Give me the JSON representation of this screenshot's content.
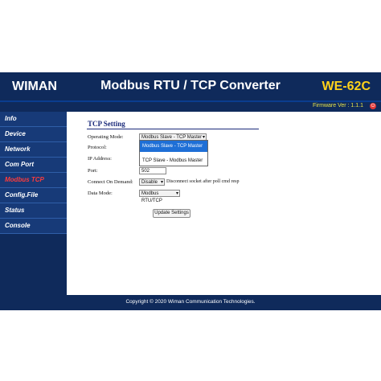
{
  "header": {
    "brand": "WIMAN",
    "product": "Modbus RTU / TCP Converter",
    "model": "WE-62C",
    "firmware": "Firmware Ver : 1.1.1"
  },
  "sidebar": {
    "items": [
      {
        "label": "Info"
      },
      {
        "label": "Device"
      },
      {
        "label": "Network"
      },
      {
        "label": "Com Port"
      },
      {
        "label": "Modbus TCP"
      },
      {
        "label": "Config.File"
      },
      {
        "label": "Status"
      },
      {
        "label": "Console"
      }
    ],
    "active": "Modbus TCP"
  },
  "form": {
    "title": "TCP Setting",
    "fields": {
      "operating_mode": {
        "label": "Operating Mode:",
        "value": "Modbus Slave - TCP Master"
      },
      "protocol": {
        "label": "Protocol:"
      },
      "ip_address": {
        "label": "IP Address:"
      },
      "port": {
        "label": "Port:",
        "value": "502"
      },
      "connect_on_demand": {
        "label": "Connect On Demand:",
        "value": "Disable",
        "note": "Disconnect socket after poll cmd resp"
      },
      "data_mode": {
        "label": "Data Mode:",
        "value": "Modbus RTU/TCP"
      }
    },
    "dropdown_options": [
      {
        "label": "Modbus Slave - TCP Master",
        "highlighted": true
      },
      {
        "label": "TCP Slave - Modbus Master",
        "highlighted": false
      }
    ],
    "submit_label": "Update Settings"
  },
  "footer": {
    "copyright": "Copyright © 2020 Wiman Communication Technologies."
  },
  "colors": {
    "header_bg": "#0f2a5b",
    "model_text": "#ffd21a",
    "active_nav": "#ff3b3b",
    "highlight": "#1e6fd6"
  }
}
